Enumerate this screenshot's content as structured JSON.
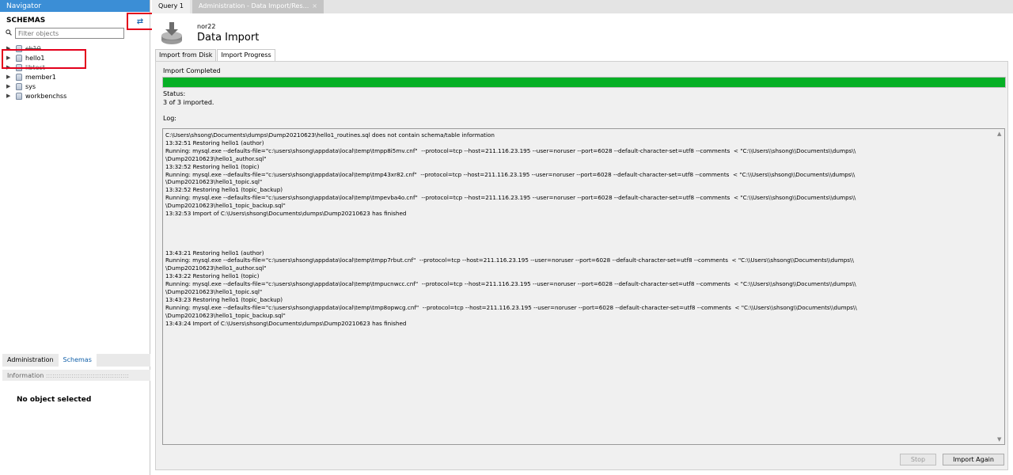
{
  "navigator": {
    "title": "Navigator",
    "schemas_header": "SCHEMAS",
    "refresh_icon": "refresh-icon",
    "filter_placeholder": "Filter objects",
    "schemas": [
      {
        "name": "cb10",
        "struck": true
      },
      {
        "name": "hello1",
        "struck": false
      },
      {
        "name": "libtest",
        "struck": true
      },
      {
        "name": "member1",
        "struck": false
      },
      {
        "name": "sys",
        "struck": false
      },
      {
        "name": "workbenchss",
        "struck": false
      }
    ],
    "bottom_tabs": [
      "Administration",
      "Schemas"
    ],
    "info_header": "Information",
    "no_object": "No object selected"
  },
  "tabs": {
    "query": "Query 1",
    "admin": "Administration - Data Import/Res...",
    "admin_close": "×"
  },
  "header": {
    "connection": "nor22",
    "title": "Data Import"
  },
  "subtabs": [
    "Import from Disk",
    "Import Progress"
  ],
  "progress": {
    "message": "Import Completed",
    "fraction": 1.0,
    "status_label": "Status:",
    "status_value": "3 of 3 imported.",
    "log_label": "Log:",
    "color": "#06b025"
  },
  "log_lines": [
    "C:\\Users\\shsong\\Documents\\dumps\\Dump20210623\\hello1_routines.sql does not contain schema/table information",
    "13:32:51 Restoring hello1 (author)",
    "Running: mysql.exe --defaults-file=\"c:\\users\\shsong\\appdata\\local\\temp\\tmpp8i5mv.cnf\"  --protocol=tcp --host=211.116.23.195 --user=noruser --port=6028 --default-character-set=utf8 --comments  < \"C:\\\\Users\\\\shsong\\\\Documents\\\\dumps\\\\",
    "\\Dump20210623\\hello1_author.sql\"",
    "13:32:52 Restoring hello1 (topic)",
    "Running: mysql.exe --defaults-file=\"c:\\users\\shsong\\appdata\\local\\temp\\tmp43xr82.cnf\"  --protocol=tcp --host=211.116.23.195 --user=noruser --port=6028 --default-character-set=utf8 --comments  < \"C:\\\\Users\\\\shsong\\\\Documents\\\\dumps\\\\",
    "\\Dump20210623\\hello1_topic.sql\"",
    "13:32:52 Restoring hello1 (topic_backup)",
    "Running: mysql.exe --defaults-file=\"c:\\users\\shsong\\appdata\\local\\temp\\tmpevba4o.cnf\"  --protocol=tcp --host=211.116.23.195 --user=noruser --port=6028 --default-character-set=utf8 --comments  < \"C:\\\\Users\\\\shsong\\\\Documents\\\\dumps\\\\",
    "\\Dump20210623\\hello1_topic_backup.sql\"",
    "13:32:53 Import of C:\\Users\\shsong\\Documents\\dumps\\Dump20210623 has finished",
    "",
    "",
    "",
    "",
    "13:43:21 Restoring hello1 (author)",
    "Running: mysql.exe --defaults-file=\"c:\\users\\shsong\\appdata\\local\\temp\\tmpp7rbut.cnf\"  --protocol=tcp --host=211.116.23.195 --user=noruser --port=6028 --default-character-set=utf8 --comments  < \"C:\\\\Users\\\\shsong\\\\Documents\\\\dumps\\\\",
    "\\Dump20210623\\hello1_author.sql\"",
    "13:43:22 Restoring hello1 (topic)",
    "Running: mysql.exe --defaults-file=\"c:\\users\\shsong\\appdata\\local\\temp\\tmpucnwcc.cnf\"  --protocol=tcp --host=211.116.23.195 --user=noruser --port=6028 --default-character-set=utf8 --comments  < \"C:\\\\Users\\\\shsong\\\\Documents\\\\dumps\\\\",
    "\\Dump20210623\\hello1_topic.sql\"",
    "13:43:23 Restoring hello1 (topic_backup)",
    "Running: mysql.exe --defaults-file=\"c:\\users\\shsong\\appdata\\local\\temp\\tmp8opwcg.cnf\"  --protocol=tcp --host=211.116.23.195 --user=noruser --port=6028 --default-character-set=utf8 --comments  < \"C:\\\\Users\\\\shsong\\\\Documents\\\\dumps\\\\",
    "\\Dump20210623\\hello1_topic_backup.sql\"",
    "13:43:24 Import of C:\\Users\\shsong\\Documents\\dumps\\Dump20210623 has finished"
  ],
  "buttons": {
    "stop": "Stop",
    "import_again": "Import Again"
  }
}
